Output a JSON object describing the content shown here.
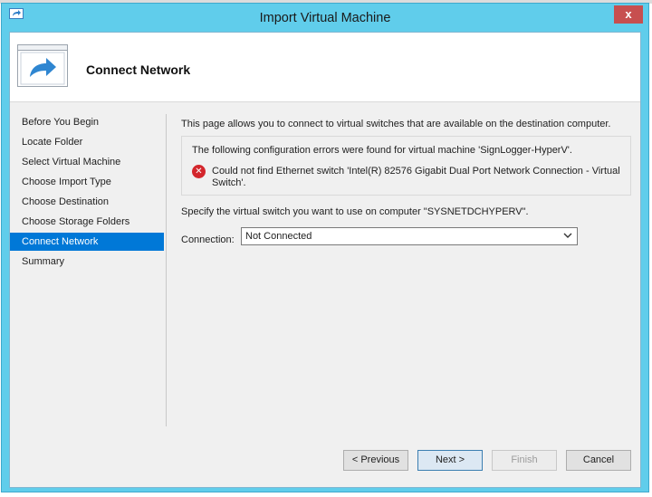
{
  "window": {
    "title": "Import Virtual Machine",
    "close_label": "x"
  },
  "header": {
    "title": "Connect Network"
  },
  "nav": {
    "items": [
      {
        "label": "Before You Begin"
      },
      {
        "label": "Locate Folder"
      },
      {
        "label": "Select Virtual Machine"
      },
      {
        "label": "Choose Import Type"
      },
      {
        "label": "Choose Destination"
      },
      {
        "label": "Choose Storage Folders"
      },
      {
        "label": "Connect Network",
        "active": true
      },
      {
        "label": "Summary"
      }
    ]
  },
  "content": {
    "intro": "This page allows you to connect to virtual switches that are available on the destination computer.",
    "error_box": {
      "heading": "The following configuration errors were found for virtual machine 'SignLogger-HyperV'.",
      "message": "Could not find Ethernet switch 'Intel(R) 82576 Gigabit Dual Port Network Connection - Virtual Switch'.",
      "icon": "error-x-icon"
    },
    "specify": "Specify the virtual switch you want to use on computer \"SYSNETDCHYPERV\".",
    "connection_label": "Connection:",
    "connection_value": "Not Connected"
  },
  "footer": {
    "previous": "< Previous",
    "next": "Next >",
    "finish": "Finish",
    "cancel": "Cancel"
  },
  "colors": {
    "titlebar": "#60cdeb",
    "selection": "#0078d7",
    "close": "#c74f4f",
    "error": "#d3262c"
  }
}
